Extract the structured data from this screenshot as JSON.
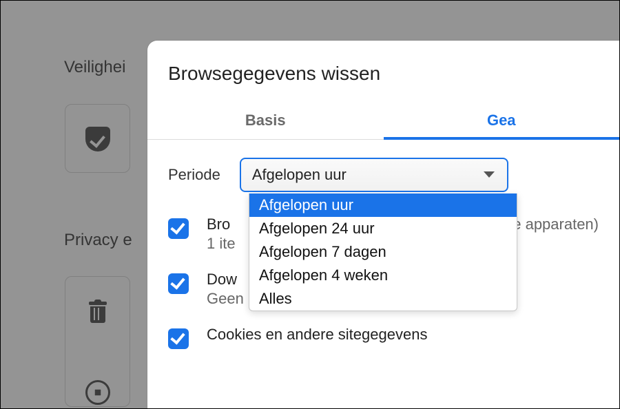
{
  "background": {
    "section1_title": "Veilighei",
    "section2_title": "Privacy e"
  },
  "dialog": {
    "title": "Browsegegevens wissen",
    "tabs": {
      "basic": "Basis",
      "advanced": "Gea"
    },
    "period": {
      "label": "Periode",
      "selected": "Afgelopen uur",
      "options": {
        "o0": "Afgelopen uur",
        "o1": "Afgelopen 24 uur",
        "o2": "Afgelopen 7 dagen",
        "o3": "Afgelopen 4 weken",
        "o4": "Alles"
      }
    },
    "rows": {
      "r0": {
        "title": "Bro",
        "sub_left": "1 ite",
        "sub_right": "e apparaten)"
      },
      "r1": {
        "title": "Dow",
        "sub": "Geen"
      },
      "r2": {
        "title": "Cookies en andere sitegegevens",
        "sub": ""
      }
    }
  }
}
